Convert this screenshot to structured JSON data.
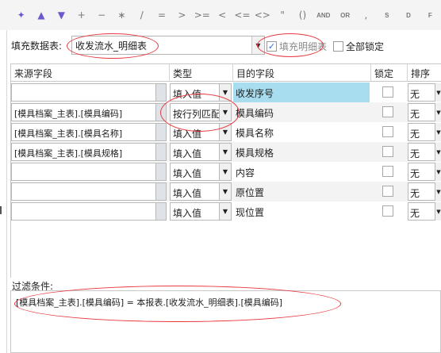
{
  "toolbar": {
    "items": [
      {
        "icon": "magic-wand-icon",
        "glyph": "✦"
      },
      {
        "icon": "move-up-icon",
        "glyph": "▲"
      },
      {
        "icon": "move-down-icon",
        "glyph": "▼"
      },
      {
        "icon": "add-icon",
        "glyph": "+"
      },
      {
        "icon": "subtract-icon",
        "glyph": "−"
      },
      {
        "icon": "multiply-icon",
        "glyph": "∗"
      },
      {
        "icon": "divide-icon",
        "glyph": "/"
      },
      {
        "icon": "equals-icon",
        "glyph": "="
      },
      {
        "icon": "greater-than-icon",
        "glyph": ">"
      },
      {
        "icon": "greater-equal-icon",
        "glyph": ">="
      },
      {
        "icon": "less-than-icon",
        "glyph": "<"
      },
      {
        "icon": "less-equal-icon",
        "glyph": "<="
      },
      {
        "icon": "not-equal-icon",
        "glyph": "<>"
      },
      {
        "icon": "quote-icon",
        "glyph": "\""
      },
      {
        "icon": "parentheses-icon",
        "glyph": "()"
      },
      {
        "icon": "and-icon",
        "glyph": "AND"
      },
      {
        "icon": "or-icon",
        "glyph": "OR"
      },
      {
        "icon": "comma-icon",
        "glyph": ","
      },
      {
        "icon": "s-icon",
        "glyph": "S"
      },
      {
        "icon": "d-icon",
        "glyph": "D"
      },
      {
        "icon": "f-icon",
        "glyph": "F"
      }
    ]
  },
  "fill_table": {
    "label": "填充数据表:",
    "value": "收发流水_明细表",
    "fill_detail_label": "填充明细表",
    "fill_detail_checked": "✓",
    "lock_all_label": "全部锁定"
  },
  "columns": {
    "source": "来源字段",
    "type": "类型",
    "dest": "目的字段",
    "lock": "锁定",
    "sort": "排序"
  },
  "rows": [
    {
      "source": "",
      "type": "填入值",
      "dest": "收发序号",
      "sort": "无"
    },
    {
      "source": "[模具档案_主表].[模具编码]",
      "type": "按行列匹配",
      "dest": "模具编码",
      "sort": "无"
    },
    {
      "source": "[模具档案_主表].[模具名称]",
      "type": "填入值",
      "dest": "模具名称",
      "sort": "无"
    },
    {
      "source": "[模具档案_主表].[模具规格]",
      "type": "填入值",
      "dest": "模具规格",
      "sort": "无"
    },
    {
      "source": "",
      "type": "填入值",
      "dest": "内容",
      "sort": "无"
    },
    {
      "source": "",
      "type": "填入值",
      "dest": "原位置",
      "sort": "无"
    },
    {
      "source": "",
      "type": "填入值",
      "dest": "现位置",
      "sort": "无"
    }
  ],
  "filter": {
    "label": "过滤条件:",
    "expression": "[模具档案_主表].[模具编码]  =  本报表.[收发流水_明细表].[模具编码]"
  },
  "colors": {
    "selected_row": "#a8dcef",
    "annotation": "#e8393f",
    "toolbar_accent": "#6a5acd"
  }
}
